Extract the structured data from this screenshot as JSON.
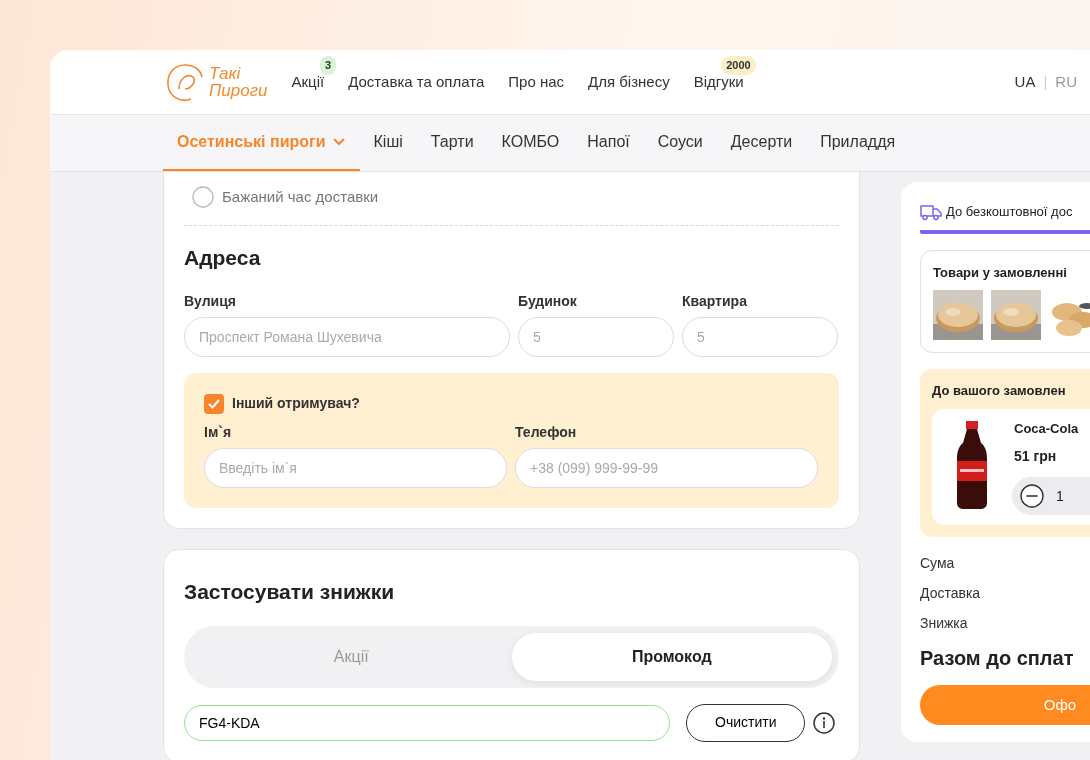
{
  "logo": {
    "line1": "Такі",
    "line2": "Пироги"
  },
  "top_nav": [
    {
      "label": "Акції",
      "badge": "3",
      "color": "#d9f3d6"
    },
    {
      "label": "Доставка та оплата"
    },
    {
      "label": "Про нас"
    },
    {
      "label": "Для бізнесу"
    },
    {
      "label": "Відгуки",
      "badge": "2000",
      "color": "#fcefc7"
    }
  ],
  "languages": [
    {
      "label": "UA",
      "selected": true
    },
    {
      "label": "RU",
      "selected": false
    }
  ],
  "language_separator": "|",
  "categories": [
    {
      "label": "Осетинські пироги",
      "selected": true,
      "has_menu": true
    },
    {
      "label": "Кіші",
      "selected": false,
      "has_menu": false
    },
    {
      "label": "Тарти",
      "selected": false,
      "has_menu": false
    },
    {
      "label": "КОМБО",
      "selected": false,
      "has_menu": false
    },
    {
      "label": "Напої",
      "selected": false,
      "has_menu": false
    },
    {
      "label": "Соуси",
      "selected": false,
      "has_menu": false
    },
    {
      "label": "Десерти",
      "selected": false,
      "has_menu": false
    },
    {
      "label": "Приладдя",
      "selected": false,
      "has_menu": false
    }
  ],
  "delivery_time_option": {
    "label": "Бажаний час доставки",
    "selected": false
  },
  "address": {
    "title": "Адреса",
    "fields": [
      {
        "label": "Вулиця",
        "placeholder": "Проспект Романа Шухевича"
      },
      {
        "label": "Будинок",
        "placeholder": "5"
      },
      {
        "label": "Квартира",
        "placeholder": "5"
      }
    ]
  },
  "other_recipient": {
    "label": "Інший отримувач?",
    "checked": true,
    "fields": [
      {
        "label": "Ім`я",
        "placeholder": "Введіть ім`я"
      },
      {
        "label": "Телефон",
        "placeholder": "+38 (099) 999-99-99"
      }
    ]
  },
  "discounts": {
    "title": "Застосувати знижки",
    "tabs": [
      {
        "label": "Акції",
        "selected": false
      },
      {
        "label": "Промокод",
        "selected": true
      }
    ],
    "promo_code": "FG4-KDA",
    "clear_button": "Очистити"
  },
  "cart": {
    "free_delivery": "До безкоштовної дос",
    "order_items": {
      "title": "Товари у замовленні"
    },
    "upsell": {
      "title": "До вашого замовлен",
      "products": [
        {
          "name": "Coca-Cola",
          "price": "51 грн",
          "quantity": "1"
        }
      ]
    },
    "totals": [
      "Сума",
      "Доставка",
      "Знижка"
    ],
    "total_label": "Разом до сплат",
    "checkout_button": "Офо"
  }
}
